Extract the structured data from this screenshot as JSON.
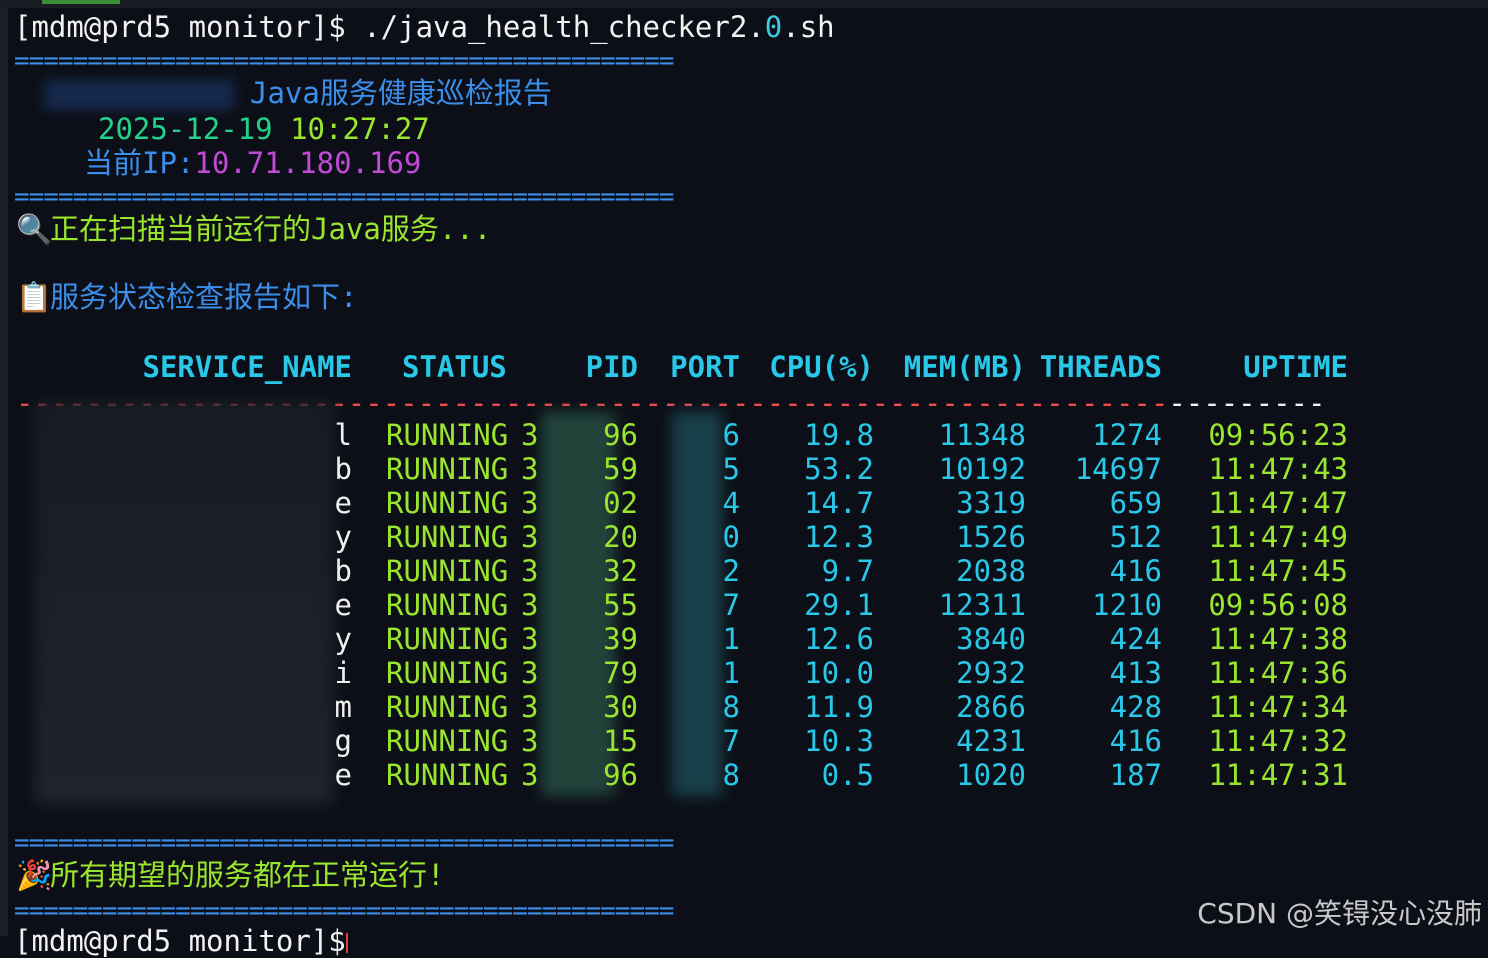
{
  "prompt": {
    "user_host": "[mdm@prd5 monitor]$ ./java_health_checker2.",
    "zero": "0",
    "ext": ".sh"
  },
  "separator": "=============================================",
  "report": {
    "title": "Java服务健康巡检报告",
    "date": "2025-12-19",
    "time": "10:27:27",
    "ip_label": "当前IP:",
    "ip": "10.71.180.169"
  },
  "scan_icon": "🔍",
  "scan_text": "正在扫描当前运行的Java服务...",
  "report_icon": "📋",
  "report_text": "服务状态检查报告如下:",
  "table": {
    "headers": [
      "SERVICE_NAME",
      "STATUS",
      "PID",
      "PORT",
      "CPU(%)",
      "MEM(MB)",
      "THREADS",
      "UPTIME"
    ],
    "rows": [
      {
        "name": "l",
        "status": "RUNNING",
        "pid_a": "3",
        "pid_b": "96",
        "port": "6",
        "cpu": "19.8",
        "mem": "11348",
        "threads": "1274",
        "uptime": "09:56:23"
      },
      {
        "name": "b",
        "status": "RUNNING",
        "pid_a": "3",
        "pid_b": "59",
        "port": "5",
        "cpu": "53.2",
        "mem": "10192",
        "threads": "14697",
        "uptime": "11:47:43"
      },
      {
        "name": "e",
        "status": "RUNNING",
        "pid_a": "3",
        "pid_b": "02",
        "port": "4",
        "cpu": "14.7",
        "mem": "3319",
        "threads": "659",
        "uptime": "11:47:47"
      },
      {
        "name": "y",
        "status": "RUNNING",
        "pid_a": "3",
        "pid_b": "20",
        "port": "0",
        "cpu": "12.3",
        "mem": "1526",
        "threads": "512",
        "uptime": "11:47:49"
      },
      {
        "name": "b",
        "status": "RUNNING",
        "pid_a": "3",
        "pid_b": "32",
        "port": "2",
        "cpu": "9.7",
        "mem": "2038",
        "threads": "416",
        "uptime": "11:47:45"
      },
      {
        "name": "e",
        "status": "RUNNING",
        "pid_a": "3",
        "pid_b": "55",
        "port": "7",
        "cpu": "29.1",
        "mem": "12311",
        "threads": "1210",
        "uptime": "09:56:08"
      },
      {
        "name": "y",
        "status": "RUNNING",
        "pid_a": "3",
        "pid_b": "39",
        "port": "1",
        "cpu": "12.6",
        "mem": "3840",
        "threads": "424",
        "uptime": "11:47:38"
      },
      {
        "name": "i",
        "status": "RUNNING",
        "pid_a": "3",
        "pid_b": "79",
        "port": "1",
        "cpu": "10.0",
        "mem": "2932",
        "threads": "413",
        "uptime": "11:47:36"
      },
      {
        "name": "m",
        "status": "RUNNING",
        "pid_a": "3",
        "pid_b": "30",
        "port": "8",
        "cpu": "11.9",
        "mem": "2866",
        "threads": "428",
        "uptime": "11:47:34"
      },
      {
        "name": "g",
        "status": "RUNNING",
        "pid_a": "3",
        "pid_b": "15",
        "port": "7",
        "cpu": "10.3",
        "mem": "4231",
        "threads": "416",
        "uptime": "11:47:32"
      },
      {
        "name": "e",
        "status": "RUNNING",
        "pid_a": "3",
        "pid_b": "96",
        "port": "8",
        "cpu": "0.5",
        "mem": "1020",
        "threads": "187",
        "uptime": "11:47:31"
      }
    ]
  },
  "done_icon": "🎉",
  "done_text": "所有期望的服务都在正常运行!",
  "bottom_prompt": "[mdm@prd5 monitor]$",
  "watermark": "CSDN @笑锝没心没肺"
}
